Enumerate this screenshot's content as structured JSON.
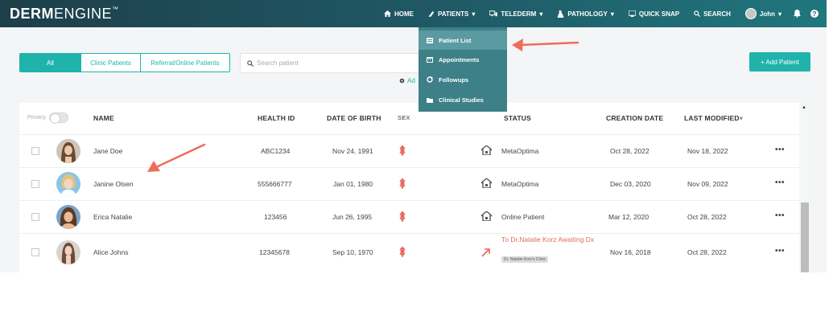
{
  "app": {
    "logo_bold": "DERM",
    "logo_light": "ENGINE",
    "logo_tm": "™"
  },
  "nav": {
    "items": [
      {
        "label": "HOME",
        "icon": "home-icon"
      },
      {
        "label": "PATIENTS",
        "icon": "patients-icon",
        "caret": true
      },
      {
        "label": "TELEDERM",
        "icon": "telederm-icon",
        "caret": true
      },
      {
        "label": "PATHOLOGY",
        "icon": "pathology-icon",
        "caret": true
      },
      {
        "label": "QUICK SNAP",
        "icon": "quick-snap-icon"
      },
      {
        "label": "SEARCH",
        "icon": "search-icon"
      },
      {
        "label": "John",
        "icon": "user-avatar",
        "caret": true
      }
    ]
  },
  "patients_menu": {
    "items": [
      {
        "label": "Patient List",
        "icon": "list-icon",
        "active": true
      },
      {
        "label": "Appointments",
        "icon": "calendar-icon"
      },
      {
        "label": "Followups",
        "icon": "refresh-icon"
      },
      {
        "label": "Clinical Studies",
        "icon": "folder-icon"
      }
    ]
  },
  "filters": {
    "tabs": [
      {
        "label": "All",
        "active": true
      },
      {
        "label": "Clinic Patients"
      },
      {
        "label": "Referral/Online Patients"
      }
    ],
    "search_placeholder": "Search patient",
    "advanced_label": "Ad",
    "add_patient_label": "+ Add Patient"
  },
  "table": {
    "privacy_label": "Privacy",
    "columns": {
      "name": "NAME",
      "health_id": "HEALTH ID",
      "dob": "DATE OF BIRTH",
      "sex": "SEX",
      "status": "STATUS",
      "creation": "CREATION DATE",
      "modified": "LAST MODIFIED",
      "modified_sort": "▾"
    },
    "rows": [
      {
        "name": "Jane Doe",
        "health_id": "ABC1234",
        "dob": "Nov 24, 1991",
        "status": "MetaOptima",
        "status_type": "clinic",
        "creation": "Oct 28, 2022",
        "modified": "Nov 18, 2022"
      },
      {
        "name": "Janine Olsen",
        "health_id": "555666777",
        "dob": "Jan 01, 1980",
        "status": "MetaOptima",
        "status_type": "clinic",
        "creation": "Dec 03, 2020",
        "modified": "Nov 09, 2022"
      },
      {
        "name": "Erica Natalie",
        "health_id": "123456",
        "dob": "Jun 26, 1995",
        "status": "Online Patient",
        "status_type": "clinic",
        "creation": "Mar 12, 2020",
        "modified": "Oct 28, 2022"
      },
      {
        "name": "Alice Johns",
        "health_id": "12345678",
        "dob": "Sep 10, 1970",
        "status": "To Dr.Natalie Korz Awaiting Dx",
        "status_type": "referral",
        "status_badge": "Dr. Natalie Korz's Clinic",
        "creation": "Nov 16, 2018",
        "modified": "Oct 28, 2022"
      }
    ],
    "row_menu": "•••"
  },
  "colors": {
    "accent": "#1fb3ac",
    "nav_dark": "#1d3f4a",
    "dropdown": "#3d8088",
    "annotation_arrow": "#ef6c5a",
    "referral_text": "#e06b5d"
  }
}
